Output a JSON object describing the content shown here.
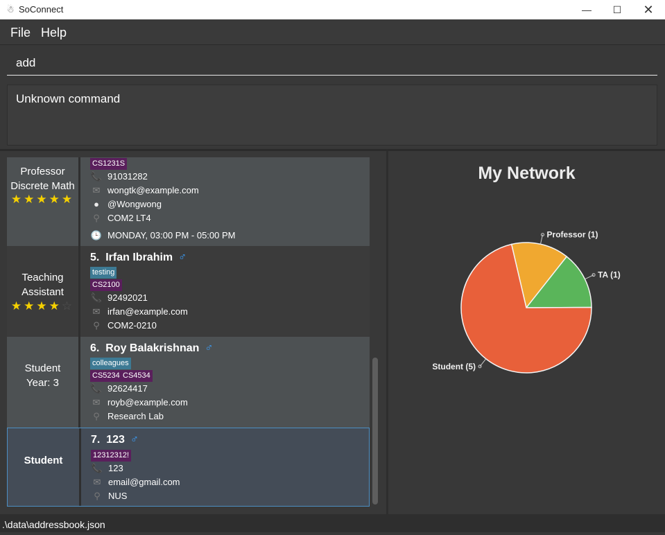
{
  "window": {
    "title": "SoConnect"
  },
  "menu": {
    "file": "File",
    "help": "Help"
  },
  "command": {
    "value": "add"
  },
  "result": {
    "text": "Unknown command"
  },
  "contacts": [
    {
      "role_lines": [
        "Professor",
        "Discrete Math"
      ],
      "stars": 5,
      "tags_purple": [
        "CS1231S"
      ],
      "phone": "91031282",
      "email": "wongtk@example.com",
      "github": "@Wongwong",
      "location": "COM2 LT4",
      "office_hours": "MONDAY, 03:00 PM - 05:00 PM"
    },
    {
      "index": "5.",
      "name": "Irfan Ibrahim",
      "role_lines": [
        "Teaching",
        "Assistant"
      ],
      "stars": 4,
      "tags_teal": [
        "testing"
      ],
      "tags_purple": [
        "CS2100"
      ],
      "phone": "92492021",
      "email": "irfan@example.com",
      "location": "COM2-0210"
    },
    {
      "index": "6.",
      "name": "Roy Balakrishnan",
      "role_lines": [
        "Student",
        "Year: 3"
      ],
      "tags_teal": [
        "colleagues"
      ],
      "tags_purple": [
        "CS5234",
        "CS4534"
      ],
      "phone": "92624417",
      "email": "royb@example.com",
      "location": "Research Lab"
    },
    {
      "index": "7.",
      "name": "123",
      "role_lines": [
        "Student"
      ],
      "tags_purple": [
        "12312312!"
      ],
      "phone": "123",
      "email": "email@gmail.com",
      "location": "NUS"
    }
  ],
  "gender_symbol": "♂",
  "network": {
    "title": "My Network"
  },
  "chart_data": {
    "type": "pie",
    "title": "My Network",
    "slices": [
      {
        "label": "Professor (1)",
        "value": 1,
        "color": "#f0a830"
      },
      {
        "label": "TA (1)",
        "value": 1,
        "color": "#5ab55a"
      },
      {
        "label": "Student (5)",
        "value": 5,
        "color": "#e8603a"
      }
    ]
  },
  "status": {
    "path": ".\\data\\addressbook.json"
  }
}
